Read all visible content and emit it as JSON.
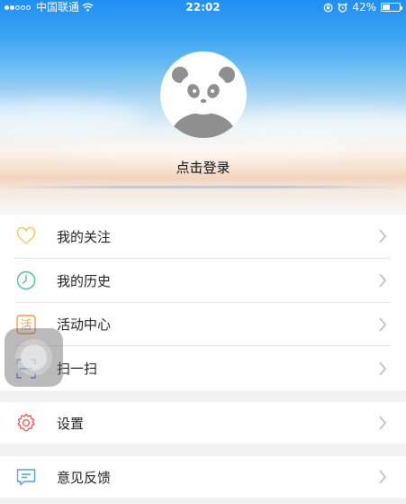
{
  "status_bar": {
    "carrier": "中国联通",
    "time": "22:02",
    "battery": "42%",
    "battery_level": 0.42
  },
  "profile": {
    "login_text": "点击登录",
    "avatar_icon": "panda-icon"
  },
  "menu": {
    "group1": [
      {
        "label": "我的关注",
        "icon": "heart-icon",
        "color": "#f2c94c"
      },
      {
        "label": "我的历史",
        "icon": "clock-icon",
        "color": "#4cc38a"
      },
      {
        "label": "活动中心",
        "icon": "activity-icon",
        "color": "#f2994a",
        "icon_text": "活"
      },
      {
        "label": "扫一扫",
        "icon": "scan-icon",
        "color": "#5b8def"
      }
    ],
    "group2": [
      {
        "label": "设置",
        "icon": "gear-icon",
        "color": "#ef5350"
      }
    ],
    "group3": [
      {
        "label": "意见反馈",
        "icon": "feedback-icon",
        "color": "#4aa3e0"
      }
    ]
  },
  "colors": {
    "sky_top": "#1f8ff2",
    "background": "#f2f2f3",
    "chevron": "#b8b8bc"
  }
}
